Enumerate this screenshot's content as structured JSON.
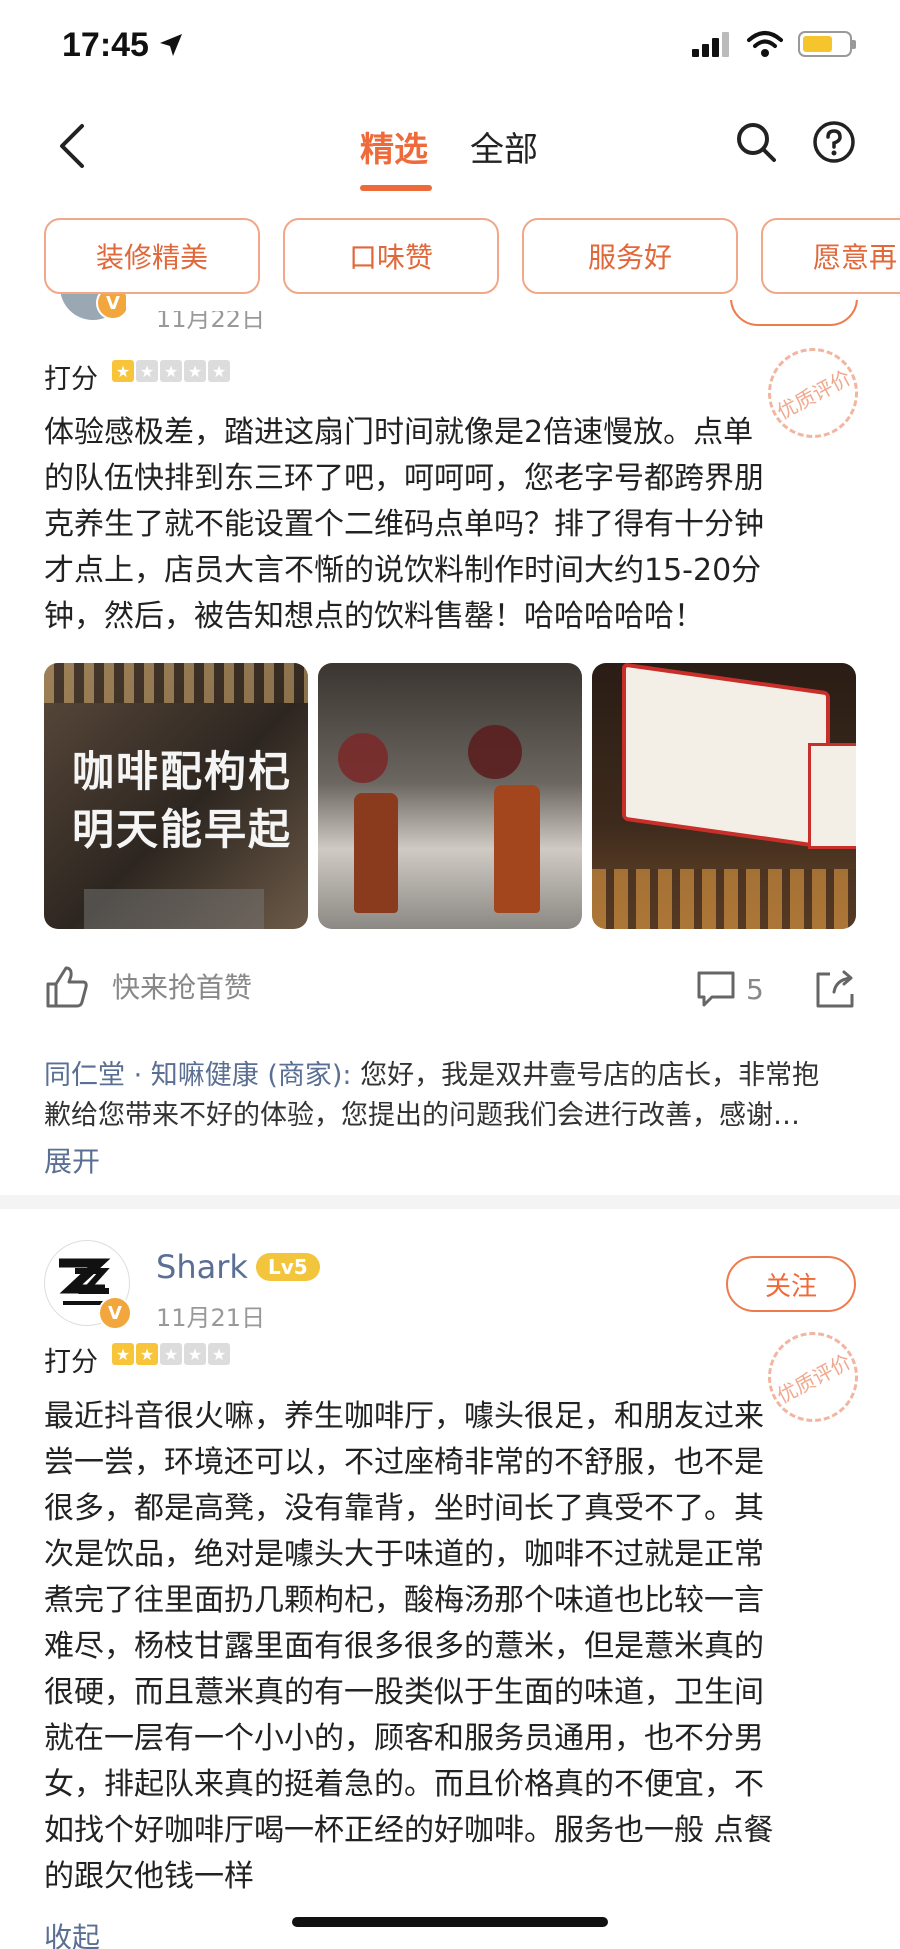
{
  "status_bar": {
    "time": "17:45"
  },
  "nav": {
    "tab_selected": "精选",
    "tab_all": "全部"
  },
  "filters": [
    "装修精美",
    "口味赞",
    "服务好",
    "愿意再"
  ],
  "review1": {
    "date": "11月22日",
    "rating_label": "打分",
    "rating": 1,
    "stamp": "优质评价",
    "text_lines": [
      "体验感极差，踏进这扇门时间就像是2倍速慢放。点单",
      "的队伍快排到东三环了吧，呵呵呵，您老字号都跨界朋",
      "克养生了就不能设置个二维码点单吗？排了得有十分钟",
      "才点上，店员大言不惭的说饮料制作时间大约15-20分",
      "钟，然后，被告知想点的饮料售罄！哈哈哈哈哈！"
    ],
    "photo1_text": [
      "咖啡配枸杞",
      "明天能早起"
    ],
    "like_text": "快来抢首赞",
    "comment_count": "5",
    "reply_merchant": "同仁堂 · 知嘛健康 (商家):",
    "reply_text_line1": " 您好，我是双井壹号店的店长，非常抱",
    "reply_text_line2": "歉给您带来不好的体验，您提出的问题我们会进行改善，感谢…",
    "expand": "展开"
  },
  "review2": {
    "username": "Shark",
    "level": "Lv5",
    "follow_label": "关注",
    "date": "11月21日",
    "rating_label": "打分",
    "rating": 2,
    "stamp": "优质评价",
    "text_lines": [
      "最近抖音很火嘛，养生咖啡厅，噱头很足，和朋友过来",
      "尝一尝，环境还可以，不过座椅非常的不舒服，也不是",
      "很多，都是高凳，没有靠背，坐时间长了真受不了。其",
      "次是饮品，绝对是噱头大于味道的，咖啡不过就是正常",
      "煮完了往里面扔几颗枸杞，酸梅汤那个味道也比较一言",
      "难尽，杨枝甘露里面有很多很多的薏米，但是薏米真的",
      "很硬，而且薏米真的有一股类似于生面的味道，卫生间",
      "就在一层有一个小小的，顾客和服务员通用，也不分男",
      "女，排起队来真的挺着急的。而且价格真的不便宜，不",
      "如找个好咖啡厅喝一杯正经的好咖啡。服务也一般 点餐",
      "的跟欠他钱一样"
    ],
    "collapse": "收起"
  }
}
